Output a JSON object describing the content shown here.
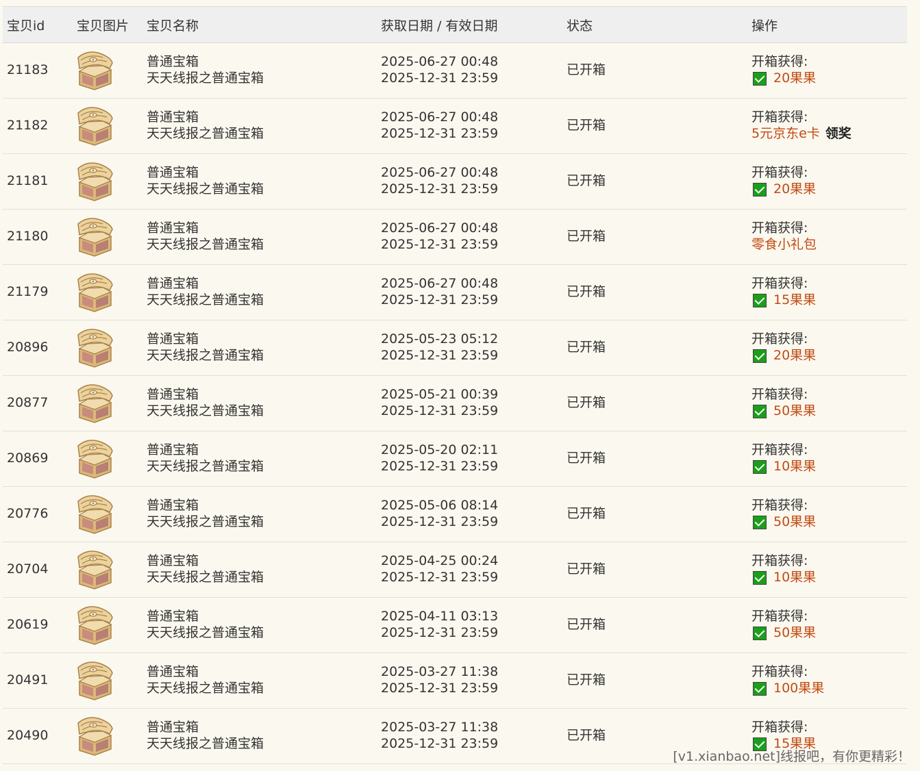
{
  "table": {
    "headers": {
      "id": "宝贝id",
      "image": "宝贝图片",
      "name": "宝贝名称",
      "dates": "获取日期 / 有效日期",
      "status": "状态",
      "action": "操作"
    },
    "rows": [
      {
        "id": "21183",
        "name": "普通宝箱",
        "desc": "天天线报之普通宝箱",
        "obtained": "2025-06-27 00:48",
        "expires": "2025-12-31 23:59",
        "status": "已开箱",
        "action_label": "开箱获得:",
        "reward": "20果果",
        "checked": true,
        "claim": ""
      },
      {
        "id": "21182",
        "name": "普通宝箱",
        "desc": "天天线报之普通宝箱",
        "obtained": "2025-06-27 00:48",
        "expires": "2025-12-31 23:59",
        "status": "已开箱",
        "action_label": "开箱获得:",
        "reward": "5元京东e卡",
        "checked": false,
        "claim": "领奖"
      },
      {
        "id": "21181",
        "name": "普通宝箱",
        "desc": "天天线报之普通宝箱",
        "obtained": "2025-06-27 00:48",
        "expires": "2025-12-31 23:59",
        "status": "已开箱",
        "action_label": "开箱获得:",
        "reward": "20果果",
        "checked": true,
        "claim": ""
      },
      {
        "id": "21180",
        "name": "普通宝箱",
        "desc": "天天线报之普通宝箱",
        "obtained": "2025-06-27 00:48",
        "expires": "2025-12-31 23:59",
        "status": "已开箱",
        "action_label": "开箱获得:",
        "reward": "零食小礼包",
        "checked": false,
        "claim": ""
      },
      {
        "id": "21179",
        "name": "普通宝箱",
        "desc": "天天线报之普通宝箱",
        "obtained": "2025-06-27 00:48",
        "expires": "2025-12-31 23:59",
        "status": "已开箱",
        "action_label": "开箱获得:",
        "reward": "15果果",
        "checked": true,
        "claim": ""
      },
      {
        "id": "20896",
        "name": "普通宝箱",
        "desc": "天天线报之普通宝箱",
        "obtained": "2025-05-23 05:12",
        "expires": "2025-12-31 23:59",
        "status": "已开箱",
        "action_label": "开箱获得:",
        "reward": "20果果",
        "checked": true,
        "claim": ""
      },
      {
        "id": "20877",
        "name": "普通宝箱",
        "desc": "天天线报之普通宝箱",
        "obtained": "2025-05-21 00:39",
        "expires": "2025-12-31 23:59",
        "status": "已开箱",
        "action_label": "开箱获得:",
        "reward": "50果果",
        "checked": true,
        "claim": ""
      },
      {
        "id": "20869",
        "name": "普通宝箱",
        "desc": "天天线报之普通宝箱",
        "obtained": "2025-05-20 02:11",
        "expires": "2025-12-31 23:59",
        "status": "已开箱",
        "action_label": "开箱获得:",
        "reward": "10果果",
        "checked": true,
        "claim": ""
      },
      {
        "id": "20776",
        "name": "普通宝箱",
        "desc": "天天线报之普通宝箱",
        "obtained": "2025-05-06 08:14",
        "expires": "2025-12-31 23:59",
        "status": "已开箱",
        "action_label": "开箱获得:",
        "reward": "50果果",
        "checked": true,
        "claim": ""
      },
      {
        "id": "20704",
        "name": "普通宝箱",
        "desc": "天天线报之普通宝箱",
        "obtained": "2025-04-25 00:24",
        "expires": "2025-12-31 23:59",
        "status": "已开箱",
        "action_label": "开箱获得:",
        "reward": "10果果",
        "checked": true,
        "claim": ""
      },
      {
        "id": "20619",
        "name": "普通宝箱",
        "desc": "天天线报之普通宝箱",
        "obtained": "2025-04-11 03:13",
        "expires": "2025-12-31 23:59",
        "status": "已开箱",
        "action_label": "开箱获得:",
        "reward": "50果果",
        "checked": true,
        "claim": ""
      },
      {
        "id": "20491",
        "name": "普通宝箱",
        "desc": "天天线报之普通宝箱",
        "obtained": "2025-03-27 11:38",
        "expires": "2025-12-31 23:59",
        "status": "已开箱",
        "action_label": "开箱获得:",
        "reward": "100果果",
        "checked": true,
        "claim": ""
      },
      {
        "id": "20490",
        "name": "普通宝箱",
        "desc": "天天线报之普通宝箱",
        "obtained": "2025-03-27 11:38",
        "expires": "2025-12-31 23:59",
        "status": "已开箱",
        "action_label": "开箱获得:",
        "reward": "15果果",
        "checked": true,
        "claim": ""
      }
    ]
  },
  "watermark": "[v1.xianbao.net]线报吧，有你更精彩！",
  "colors": {
    "background": "#fbf8ef",
    "header_bg": "#efefef",
    "reward": "#c24a12",
    "checkbox": "#1a9f1a"
  },
  "icons": {
    "row_image": "treasure-chest-icon",
    "checked": "checkbox-checked-icon"
  }
}
